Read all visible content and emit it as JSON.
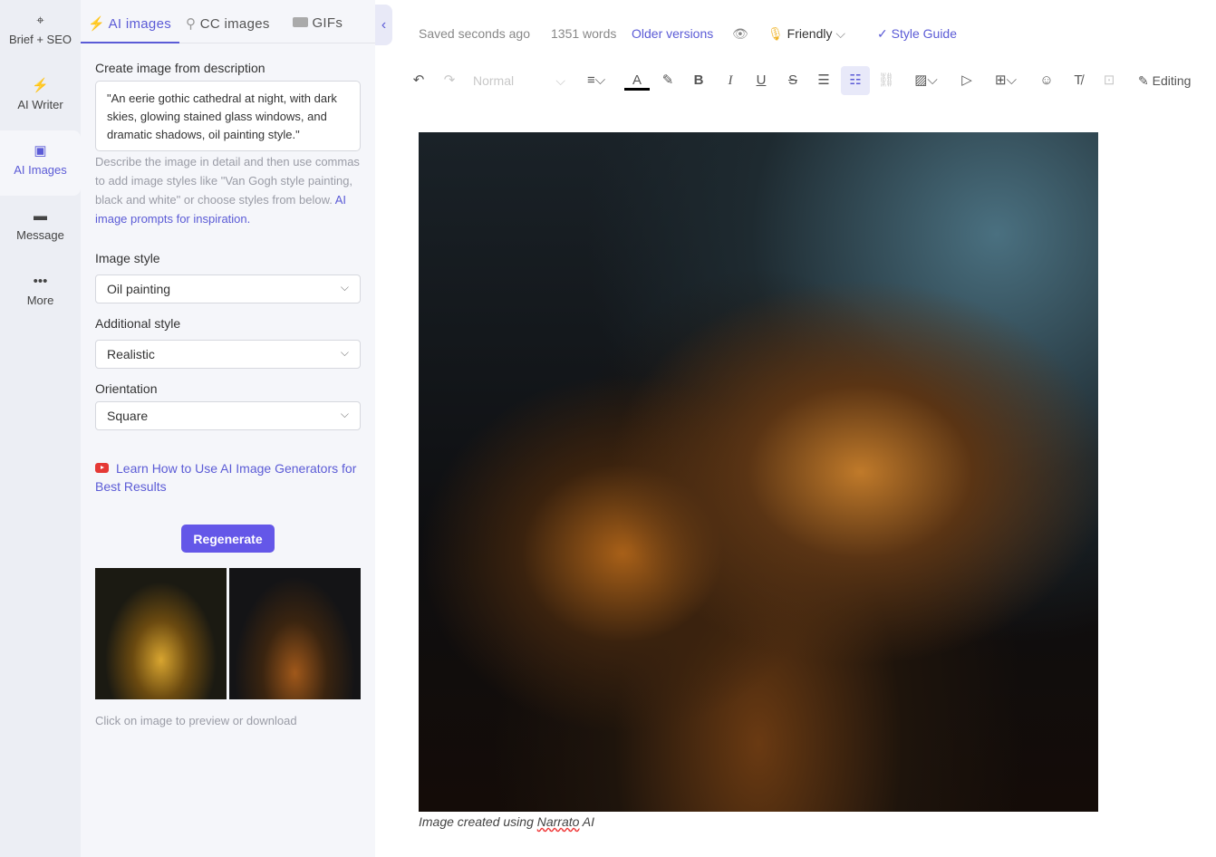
{
  "rail": {
    "items": [
      {
        "label": "Brief + SEO",
        "icon": "crosshair-icon"
      },
      {
        "label": "AI Writer",
        "icon": "lightning-icon"
      },
      {
        "label": "AI Images",
        "icon": "image-icon"
      },
      {
        "label": "Message",
        "icon": "chat-icon"
      },
      {
        "label": "More",
        "icon": "more-icon"
      }
    ]
  },
  "panel": {
    "tabs": [
      {
        "label": "AI images"
      },
      {
        "label": "CC images"
      },
      {
        "label": "GIFs"
      }
    ],
    "create_label": "Create image from description",
    "prompt": "\"An eerie gothic cathedral at night, with dark skies, glowing stained glass windows, and dramatic shadows, oil painting style.\"",
    "help_text": "Describe the image in detail and then use commas to add image styles like \"Van Gogh style painting, black and white\" or choose styles from below.",
    "help_link": "AI image prompts for inspiration.",
    "image_style_label": "Image style",
    "image_style": "Oil painting",
    "additional_style_label": "Additional style",
    "additional_style": "Realistic",
    "orientation_label": "Orientation",
    "orientation": "Square",
    "learn_link": "Learn How to Use AI Image Generators for Best Results",
    "regenerate": "Regenerate",
    "footer": "Click on image to preview or download"
  },
  "status": {
    "saved": "Saved seconds ago",
    "words": "1351 words",
    "older": "Older versions",
    "tone": "Friendly",
    "style_guide": "Style Guide"
  },
  "toolbar": {
    "format": "Normal",
    "mode": "Editing",
    "text_color": "#000000",
    "accent": "#5b5bd6"
  },
  "editor": {
    "caption_prefix": "Image created using ",
    "caption_brand": "Narrato",
    "caption_suffix": " AI"
  }
}
